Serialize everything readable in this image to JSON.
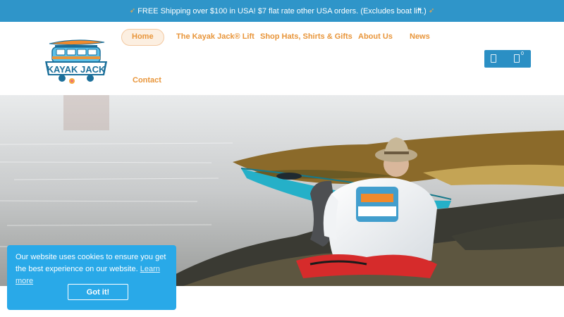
{
  "announcement": {
    "text": "FREE Shipping over $100 in USA! $7 flat rate other USA orders. (Excludes boat lift.)",
    "close_label": "×"
  },
  "logo": {
    "text": "KAYAK JACK"
  },
  "nav": {
    "items": [
      {
        "label": "Home",
        "active": true
      },
      {
        "label": "The Kayak Jack® Lift"
      },
      {
        "label": "Shop Hats, Shirts & Gifts"
      },
      {
        "label": "About Us"
      },
      {
        "label": "News"
      },
      {
        "label": "Contact"
      }
    ]
  },
  "cart": {
    "count": "0"
  },
  "cookie": {
    "message": "Our website uses cookies to ensure you get the best experience on our website.",
    "learn_more": "Learn more",
    "button": "Got it!"
  },
  "colors": {
    "topbar": "#2f95c9",
    "nav_text": "#e8953a",
    "cookie_bg": "#29a9e8"
  }
}
